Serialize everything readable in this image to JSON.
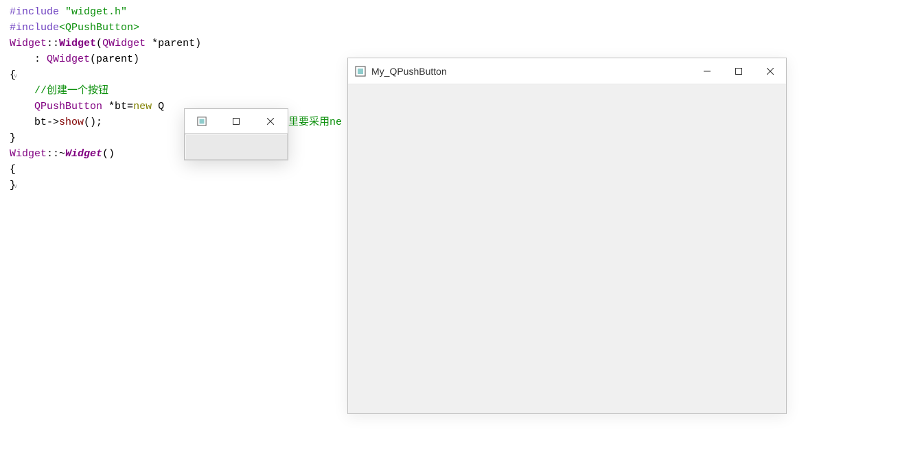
{
  "code": {
    "lines": [
      {
        "segments": [
          {
            "cls": "directive",
            "t": "#include "
          },
          {
            "cls": "string",
            "t": "\"widget.h\""
          }
        ]
      },
      {
        "segments": [
          {
            "cls": "directive",
            "t": "#include"
          },
          {
            "cls": "anglebr",
            "t": "<QPushButton>"
          }
        ]
      },
      {
        "segments": [
          {
            "cls": "",
            "t": ""
          }
        ]
      },
      {
        "segments": [
          {
            "cls": "type",
            "t": "Widget"
          },
          {
            "cls": "punct",
            "t": "::"
          },
          {
            "cls": "func-def",
            "t": "Widget"
          },
          {
            "cls": "punct",
            "t": "("
          },
          {
            "cls": "type",
            "t": "QWidget"
          },
          {
            "cls": "ident",
            "t": " *parent"
          },
          {
            "cls": "punct",
            "t": ")"
          }
        ]
      },
      {
        "marker": "˅",
        "segments": [
          {
            "cls": "ident",
            "t": "    : "
          },
          {
            "cls": "type",
            "t": "QWidget"
          },
          {
            "cls": "punct",
            "t": "(parent)"
          }
        ]
      },
      {
        "segments": [
          {
            "cls": "punct",
            "t": "{"
          }
        ]
      },
      {
        "segments": [
          {
            "cls": "comment",
            "t": "    //创建一个按钮"
          }
        ]
      },
      {
        "segments": [
          {
            "cls": "ident",
            "t": "    "
          },
          {
            "cls": "type",
            "t": "QPushButton"
          },
          {
            "cls": "ident",
            "t": " *bt="
          },
          {
            "cls": "new",
            "t": "new"
          },
          {
            "cls": "ident",
            "t": " Q"
          }
        ],
        "trailing": "里要采用ne"
      },
      {
        "segments": [
          {
            "cls": "ident",
            "t": "    bt->"
          },
          {
            "cls": "method",
            "t": "show"
          },
          {
            "cls": "punct",
            "t": "();"
          }
        ]
      },
      {
        "segments": [
          {
            "cls": "punct",
            "t": "}"
          }
        ]
      },
      {
        "segments": [
          {
            "cls": "",
            "t": ""
          }
        ]
      },
      {
        "marker": "˅",
        "segments": [
          {
            "cls": "type",
            "t": "Widget"
          },
          {
            "cls": "punct",
            "t": "::~"
          },
          {
            "cls": "func-def-italic",
            "t": "Widget"
          },
          {
            "cls": "punct",
            "t": "()"
          }
        ]
      },
      {
        "segments": [
          {
            "cls": "punct",
            "t": "{"
          }
        ]
      },
      {
        "segments": [
          {
            "cls": "",
            "t": ""
          }
        ]
      },
      {
        "segments": [
          {
            "cls": "punct",
            "t": "}"
          }
        ]
      }
    ]
  },
  "main_window": {
    "title": "My_QPushButton"
  },
  "small_window": {
    "title": ""
  }
}
